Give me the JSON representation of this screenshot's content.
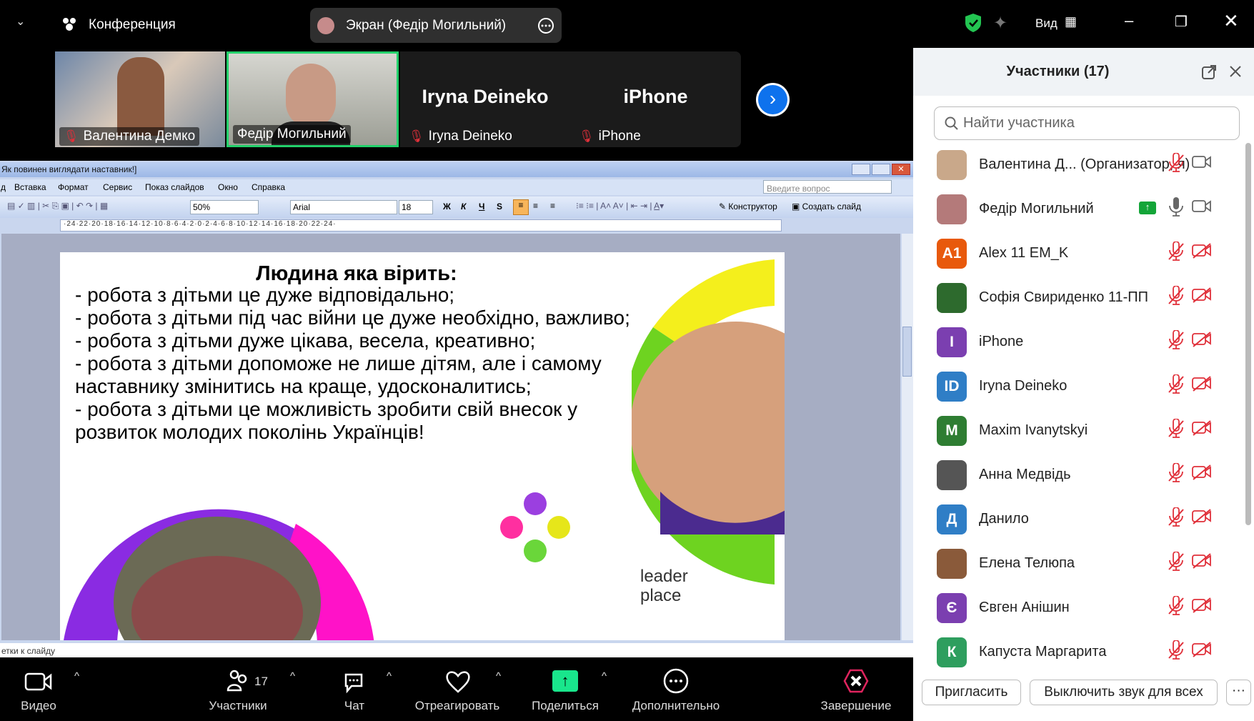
{
  "topbar": {
    "meeting_label": "Конференция",
    "share_label": "Экран (Федір Могильний)",
    "view_label": "Вид"
  },
  "video_strip": [
    {
      "name": "Валентина Демко",
      "muted": true
    },
    {
      "name": "Федір Могильний",
      "muted": false,
      "active": true
    },
    {
      "name": "Iryna Deineko",
      "big": "Iryna Deineko",
      "muted": true
    },
    {
      "name": "iPhone",
      "big": "iPhone",
      "muted": true
    }
  ],
  "ppt": {
    "title": "Як повинен виглядати наставник!]",
    "menu": [
      "д",
      "Вставка",
      "Формат",
      "Сервис",
      "Показ слайдов",
      "Окно",
      "Справка"
    ],
    "help_placeholder": "Введите вопрос",
    "zoom": "50%",
    "font": "Arial",
    "size": "18",
    "format_buttons": [
      "Ж",
      "К",
      "Ч",
      "S"
    ],
    "designer": "Конструктор",
    "new_slide": "Создать слайд",
    "ruler": "·24·22·20·18·16·14·12·10·8·6·4·2·0·2·4·6·8·10·12·14·16·18·20·22·24·",
    "status": "етки к слайду"
  },
  "slide": {
    "title": "Людина яка вірить:",
    "bullets": [
      "- робота з дітьми це дуже відповідально;",
      "- робота з дітьми під час війни це дуже необхідно, важливо;",
      "- робота з дітьми дуже цікава, весела, креативно;",
      "- робота з дітьми допоможе не лише дітям, але і самому наставнику змінитись на краще, удосконалитись;",
      "- робота з дітьми це можливість зробити свій внесок у розвиток молодих поколінь Українців!"
    ],
    "logo_line1": "leader",
    "logo_line2": "place"
  },
  "bottombar": {
    "video": "Видео",
    "participants": "Участники",
    "participants_count": "17",
    "chat": "Чат",
    "react": "Отреагировать",
    "share": "Поделиться",
    "more": "Дополнительно",
    "end": "Завершение"
  },
  "panel": {
    "title": "Участники (17)",
    "search_placeholder": "Найти участника",
    "participants": [
      {
        "name": "Валентина Д... (Организатор, я)",
        "initials": "",
        "color": "#c9a88a",
        "mic": "muted",
        "cam": "on"
      },
      {
        "name": "Федір Могильний",
        "initials": "",
        "color": "#b47a7a",
        "mic": "on",
        "cam": "on",
        "sharing": true
      },
      {
        "name": "Alex 11 EM_K",
        "initials": "A1",
        "color": "#e8590c",
        "mic": "muted",
        "cam": "off"
      },
      {
        "name": "Софія Свириденко 11-ПП",
        "initials": "",
        "color": "#2d6a2d",
        "mic": "muted",
        "cam": "off"
      },
      {
        "name": "iPhone",
        "initials": "I",
        "color": "#7b3fb0",
        "mic": "muted",
        "cam": "off"
      },
      {
        "name": "Iryna Deineko",
        "initials": "ID",
        "color": "#2f7ec6",
        "mic": "muted",
        "cam": "off"
      },
      {
        "name": "Maxim Ivanytskyi",
        "initials": "M",
        "color": "#2e7d32",
        "mic": "muted",
        "cam": "off"
      },
      {
        "name": "Анна Медвідь",
        "initials": "",
        "color": "#555",
        "mic": "muted",
        "cam": "off"
      },
      {
        "name": "Данило",
        "initials": "Д",
        "color": "#2f7ec6",
        "mic": "muted",
        "cam": "off"
      },
      {
        "name": "Елена Телюпа",
        "initials": "",
        "color": "#8a5a3a",
        "mic": "muted",
        "cam": "off"
      },
      {
        "name": "Євген Анішин",
        "initials": "Є",
        "color": "#7b3fb0",
        "mic": "muted",
        "cam": "off"
      },
      {
        "name": "Капуста Маргарита",
        "initials": "К",
        "color": "#2e9e5e",
        "mic": "muted",
        "cam": "off"
      }
    ],
    "invite": "Пригласить",
    "mute_all": "Выключить звук для всех",
    "more": "···"
  }
}
